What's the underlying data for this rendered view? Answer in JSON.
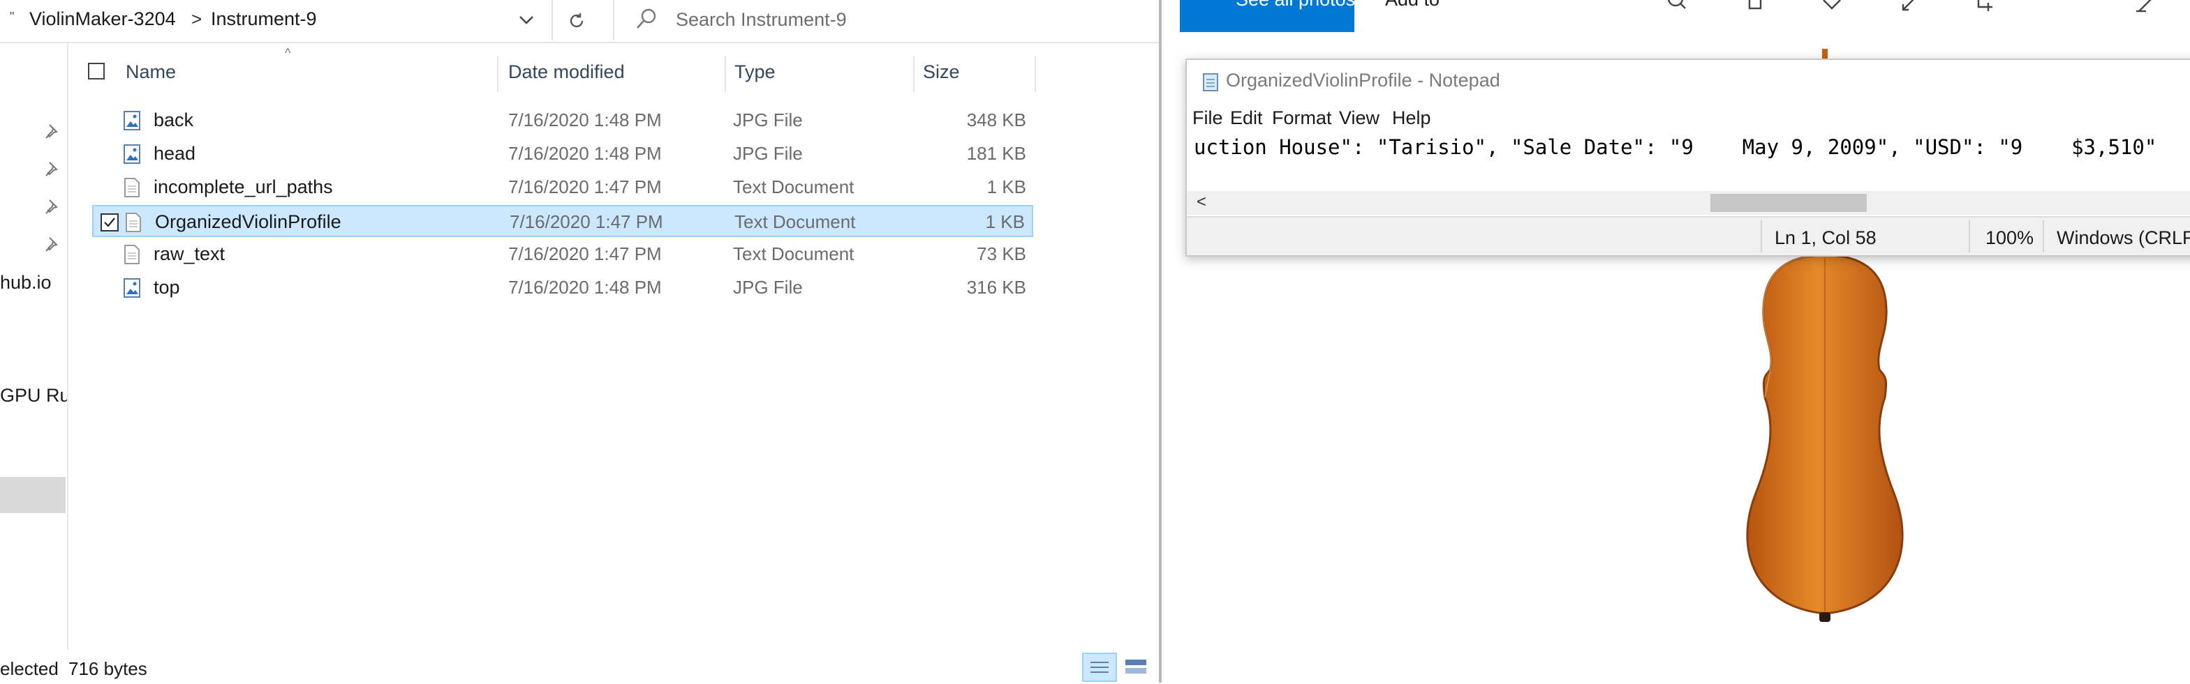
{
  "explorer": {
    "breadcrumb": {
      "lead": "\"",
      "items": [
        "ViolinMaker-3204",
        "Instrument-9"
      ],
      "separator": ">"
    },
    "search_placeholder": "Search Instrument-9",
    "nav": {
      "items": [
        "hub.io",
        "GPU Ru"
      ]
    },
    "columns": {
      "name": "Name",
      "date": "Date modified",
      "type": "Type",
      "size": "Size"
    },
    "files": [
      {
        "name": "back",
        "date": "7/16/2020 1:48 PM",
        "type": "JPG File",
        "size": "348 KB",
        "icon": "jpg-file-icon",
        "selected": false
      },
      {
        "name": "head",
        "date": "7/16/2020 1:48 PM",
        "type": "JPG File",
        "size": "181 KB",
        "icon": "jpg-file-icon",
        "selected": false
      },
      {
        "name": "incomplete_url_paths",
        "date": "7/16/2020 1:47 PM",
        "type": "Text Document",
        "size": "1 KB",
        "icon": "text-file-icon",
        "selected": false
      },
      {
        "name": "OrganizedViolinProfile",
        "date": "7/16/2020 1:47 PM",
        "type": "Text Document",
        "size": "1 KB",
        "icon": "text-file-icon",
        "selected": true
      },
      {
        "name": "raw_text",
        "date": "7/16/2020 1:47 PM",
        "type": "Text Document",
        "size": "73 KB",
        "icon": "text-file-icon",
        "selected": false
      },
      {
        "name": "top",
        "date": "7/16/2020 1:48 PM",
        "type": "JPG File",
        "size": "316 KB",
        "icon": "jpg-file-icon",
        "selected": false
      }
    ],
    "status": {
      "selection": "elected",
      "bytes": "716 bytes"
    }
  },
  "photos": {
    "see_all": "See all photos",
    "add_to": "Add to"
  },
  "notepad": {
    "title": "OrganizedViolinProfile - Notepad",
    "menu": [
      "File",
      "Edit",
      "Format",
      "View",
      "Help"
    ],
    "line": "uction House\": \"Tarisio\", \"Sale Date\": \"9    May 9, 2009\", \"USD\": \"9    $3,510\"",
    "scroll_left": "<",
    "status": {
      "position": "Ln 1, Col 58",
      "zoom": "100%",
      "line_ending": "Windows (CRLF)"
    }
  },
  "colors": {
    "selection_bg": "#cce8ff",
    "selection_border": "#99d1ff",
    "accent": "#0078d4",
    "violin": "#d9711a"
  }
}
